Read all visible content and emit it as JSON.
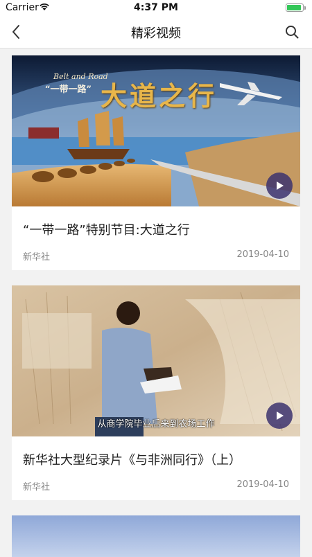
{
  "status_bar": {
    "carrier": "Carrier",
    "time": "4:37 PM",
    "battery_level": 0.9,
    "battery_color": "#34c759"
  },
  "nav": {
    "title": "精彩视频",
    "back_icon": "chevron-left-icon",
    "search_icon": "search-icon"
  },
  "videos": [
    {
      "thumb_text_en": "Belt and Road",
      "thumb_text_cn_small": "“一带一路”",
      "thumb_text_cn_large": "大道之行",
      "title": "“一带一路”特别节目:大道之行",
      "source": "新华社",
      "date": "2019-04-10",
      "play_icon": "play-icon"
    },
    {
      "thumb_subtitle": "从商学院毕业后来到农场工作",
      "title": "新华社大型纪录片《与非洲同行》（上）",
      "source": "新华社",
      "date": "2019-04-10",
      "play_icon": "play-icon"
    }
  ],
  "colors": {
    "play_button": "#3c326e",
    "divider": "#e0e0e0",
    "meta_text": "#888888"
  }
}
